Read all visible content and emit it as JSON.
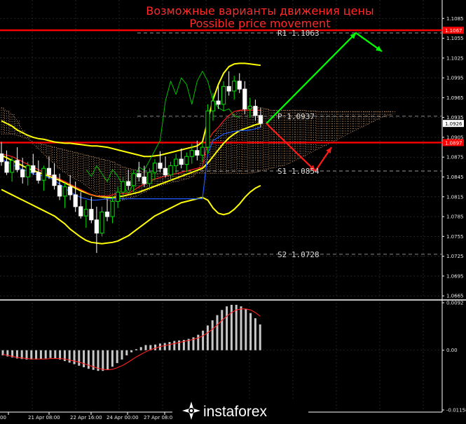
{
  "title_ru": "Возможные варианты движения цены",
  "title_en": "Possible price movement",
  "logo_text": "instaforex",
  "colors": {
    "background": "#000000",
    "title": "#ff2a2a",
    "bull_candle": "#00e000",
    "bear_candle": "#ffffff",
    "bollinger": "#ffff00",
    "kijun": "#ff2020",
    "tenkan": "#1e5aff",
    "chikou": "#00c000",
    "cloud": "#d2a070",
    "level_line": "#ff0000",
    "arrow_up": "#00ff00",
    "arrow_down": "#ff1a1a",
    "histogram": "#c8c8c8",
    "signal": "#ff2020"
  },
  "chart_data": [
    {
      "type": "candlestick",
      "price_axis_ticks": [
        "1.1085",
        "1.1055",
        "1.1025",
        "1.0995",
        "1.0965",
        "1.0935",
        "1.0905",
        "1.0875",
        "1.0845",
        "1.0815",
        "1.0785",
        "1.0755",
        "1.0725",
        "1.0695",
        "1.0665"
      ],
      "ylim": [
        1.0662,
        1.1098
      ],
      "time_axis_ticks": [
        "00",
        "21 Apr 08:00",
        "22 Apr 16:00",
        "24 Apr 00:00",
        "27 Apr 08:00",
        "28 Ap"
      ],
      "price_badges": [
        {
          "label": "1.1067",
          "value": 1.1067,
          "color": "#ff0000"
        },
        {
          "label": "1.0926",
          "value": 1.0926,
          "color": "#ffffff"
        },
        {
          "label": "1.0897",
          "value": 1.0897,
          "color": "#ff0000"
        }
      ],
      "levels": [
        {
          "label": "R1 1.1063",
          "value": 1.1063,
          "style": "dash"
        },
        {
          "label": "P 1.0937",
          "value": 1.0937,
          "style": "dash"
        },
        {
          "label": "S1 1.0854",
          "value": 1.0854,
          "style": "dash"
        },
        {
          "label": "S2 1.0728",
          "value": 1.0728,
          "style": "dash"
        }
      ],
      "red_lines": [
        1.1067,
        1.0897
      ],
      "candles": [
        [
          1.088,
          1.0898,
          1.0862,
          1.0868
        ],
        [
          1.0868,
          1.0885,
          1.0848,
          1.0852
        ],
        [
          1.0852,
          1.0875,
          1.0838,
          1.087
        ],
        [
          1.087,
          1.089,
          1.0852,
          1.0856
        ],
        [
          1.0856,
          1.0874,
          1.0835,
          1.0845
        ],
        [
          1.0845,
          1.0868,
          1.0832,
          1.0862
        ],
        [
          1.0862,
          1.088,
          1.0848,
          1.0852
        ],
        [
          1.0852,
          1.087,
          1.0835,
          1.084
        ],
        [
          1.084,
          1.0862,
          1.0824,
          1.0858
        ],
        [
          1.0858,
          1.0876,
          1.0842,
          1.0848
        ],
        [
          1.0848,
          1.0866,
          1.0826,
          1.0832
        ],
        [
          1.0832,
          1.085,
          1.081,
          1.0816
        ],
        [
          1.0816,
          1.0836,
          1.0798,
          1.083
        ],
        [
          1.083,
          1.0848,
          1.081,
          1.0818
        ],
        [
          1.0818,
          1.0838,
          1.0792,
          1.08
        ],
        [
          1.08,
          1.0822,
          1.0782,
          1.0786
        ],
        [
          1.0786,
          1.081,
          1.0768,
          1.0796
        ],
        [
          1.0796,
          1.0815,
          1.0775,
          1.078
        ],
        [
          1.078,
          1.08,
          1.073,
          1.076
        ],
        [
          1.076,
          1.08,
          1.0755,
          1.0792
        ],
        [
          1.0792,
          1.0812,
          1.0778,
          1.0785
        ],
        [
          1.0785,
          1.0815,
          1.0775,
          1.0808
        ],
        [
          1.0808,
          1.083,
          1.0798,
          1.0822
        ],
        [
          1.0822,
          1.0845,
          1.081,
          1.0838
        ],
        [
          1.0838,
          1.0856,
          1.0825,
          1.0832
        ],
        [
          1.0832,
          1.0855,
          1.0822,
          1.085
        ],
        [
          1.085,
          1.0868,
          1.0838,
          1.0845
        ],
        [
          1.0845,
          1.0862,
          1.083,
          1.0835
        ],
        [
          1.0835,
          1.0858,
          1.0825,
          1.0852
        ],
        [
          1.0852,
          1.0872,
          1.084,
          1.0866
        ],
        [
          1.0866,
          1.0884,
          1.0852,
          1.0858
        ],
        [
          1.0858,
          1.0876,
          1.0844,
          1.0848
        ],
        [
          1.0848,
          1.0868,
          1.0838,
          1.0862
        ],
        [
          1.0862,
          1.088,
          1.085,
          1.0872
        ],
        [
          1.0872,
          1.0888,
          1.0858,
          1.0864
        ],
        [
          1.0864,
          1.0882,
          1.0852,
          1.0876
        ],
        [
          1.0876,
          1.0895,
          1.0865,
          1.0885
        ],
        [
          1.0885,
          1.09,
          1.087,
          1.0878
        ],
        [
          1.0878,
          1.0898,
          1.0868,
          1.089
        ],
        [
          1.089,
          1.0955,
          1.088,
          1.0945
        ],
        [
          1.0945,
          1.0972,
          1.093,
          1.096
        ],
        [
          1.096,
          1.0985,
          1.0948,
          1.0955
        ],
        [
          1.0955,
          1.099,
          1.0945,
          1.0982
        ],
        [
          1.0982,
          1.1005,
          1.0968,
          1.0975
        ],
        [
          1.0975,
          1.0998,
          1.0962,
          1.099
        ],
        [
          1.099,
          1.1002,
          1.0972,
          1.0978
        ],
        [
          1.0978,
          1.099,
          1.094,
          1.0948
        ],
        [
          1.0948,
          1.0965,
          1.0935,
          1.0952
        ],
        [
          1.0952,
          1.0962,
          1.093,
          1.0938
        ],
        [
          1.0938,
          1.095,
          1.092,
          1.0926
        ]
      ],
      "bollinger_upper": [
        1.093,
        1.0926,
        1.0922,
        1.0916,
        1.0912,
        1.0908,
        1.0905,
        1.0903,
        1.0902,
        1.09,
        1.0898,
        1.0897,
        1.0896,
        1.0896,
        1.0895,
        1.0894,
        1.0893,
        1.0892,
        1.0892,
        1.0891,
        1.089,
        1.0888,
        1.0886,
        1.0884,
        1.0882,
        1.088,
        1.0878,
        1.0876,
        1.0876,
        1.0877,
        1.0878,
        1.088,
        1.0882,
        1.0884,
        1.0886,
        1.0888,
        1.089,
        1.0892,
        1.0898,
        1.093,
        1.0962,
        1.0985,
        1.1002,
        1.1012,
        1.1016,
        1.1017,
        1.1017,
        1.1016,
        1.1015,
        1.1014
      ],
      "bollinger_middle": [
        1.0878,
        1.0874,
        1.087,
        1.0866,
        1.0862,
        1.0858,
        1.0855,
        1.0852,
        1.0849,
        1.0846,
        1.0843,
        1.084,
        1.0836,
        1.0832,
        1.0828,
        1.0824,
        1.0821,
        1.0818,
        1.0816,
        1.0815,
        1.0814,
        1.0814,
        1.0815,
        1.0816,
        1.0818,
        1.082,
        1.0822,
        1.0825,
        1.0828,
        1.0831,
        1.0834,
        1.0837,
        1.084,
        1.0843,
        1.0846,
        1.0849,
        1.0852,
        1.0855,
        1.0858,
        1.0866,
        1.0876,
        1.0886,
        1.0896,
        1.0904,
        1.091,
        1.0915,
        1.0918,
        1.0921,
        1.0924,
        1.0926
      ],
      "bollinger_lower": [
        1.0826,
        1.0822,
        1.0818,
        1.0814,
        1.081,
        1.0806,
        1.0802,
        1.0798,
        1.0794,
        1.079,
        1.0786,
        1.078,
        1.0774,
        1.0766,
        1.076,
        1.0754,
        1.0749,
        1.0746,
        1.0745,
        1.0744,
        1.0745,
        1.0746,
        1.0748,
        1.0752,
        1.0756,
        1.0762,
        1.0768,
        1.0774,
        1.078,
        1.0786,
        1.079,
        1.0794,
        1.0798,
        1.0802,
        1.0806,
        1.0808,
        1.081,
        1.0812,
        1.0814,
        1.081,
        1.0798,
        1.079,
        1.0788,
        1.079,
        1.0796,
        1.0804,
        1.0814,
        1.0822,
        1.0828,
        1.0832
      ],
      "tenkan": [
        1.0872,
        1.0868,
        1.0864,
        1.086,
        1.0856,
        1.0853,
        1.085,
        1.0848,
        1.0846,
        1.0844,
        1.084,
        1.0834,
        1.0828,
        1.0822,
        1.0818,
        1.0814,
        1.0812,
        1.081,
        1.081,
        1.0811,
        1.0812,
        1.0812,
        1.0812,
        1.0812,
        1.0812,
        1.0812,
        1.0812,
        1.0812,
        1.0812,
        1.0812,
        1.0812,
        1.0812,
        1.0812,
        1.0812,
        1.0812,
        1.0812,
        1.0812,
        1.0812,
        1.0812,
        1.088,
        1.09,
        1.0905,
        1.091,
        1.0912,
        1.0914,
        1.0915,
        1.0915,
        1.0916,
        1.0918,
        1.092
      ],
      "kijun": [
        1.088,
        1.0878,
        1.0876,
        1.0872,
        1.0868,
        1.0864,
        1.086,
        1.0856,
        1.0852,
        1.0848,
        1.0846,
        1.0842,
        1.0838,
        1.0834,
        1.083,
        1.0826,
        1.0822,
        1.0818,
        1.0816,
        1.0816,
        1.0816,
        1.0818,
        1.082,
        1.082,
        1.082,
        1.0825,
        1.083,
        1.0834,
        1.0838,
        1.0842,
        1.0844,
        1.0846,
        1.0848,
        1.085,
        1.0852,
        1.0854,
        1.0856,
        1.0858,
        1.086,
        1.09,
        1.0912,
        1.092,
        1.093,
        1.0938,
        1.0944,
        1.0946,
        1.0946,
        1.0946,
        1.0946,
        1.0946
      ],
      "chikou": [
        1.0856,
        1.0846,
        1.0862,
        1.085,
        1.0838,
        1.0856,
        1.0846,
        1.0832,
        1.082,
        1.0836,
        1.086,
        1.0855,
        1.087,
        1.0885,
        1.09,
        1.096,
        1.099,
        1.097,
        1.0995,
        1.0985,
        1.0955,
        1.099,
        1.1005,
        1.099,
        1.096,
        1.095,
        1.0945,
        1.0948,
        1.0938,
        1.0935
      ],
      "cloud_a": [
        1.095,
        1.0945,
        1.094,
        1.093,
        1.0915,
        1.0905,
        1.0895,
        1.0888,
        1.088,
        1.0872,
        1.0865,
        1.0858,
        1.0852,
        1.0846,
        1.0842,
        1.0838,
        1.0832,
        1.0826,
        1.082,
        1.0814,
        1.081,
        1.0808,
        1.0808,
        1.081,
        1.0812,
        1.0814,
        1.0818,
        1.0822,
        1.0826,
        1.083,
        1.0832,
        1.0834,
        1.0836,
        1.0838,
        1.084,
        1.0842,
        1.0845,
        1.0852,
        1.087,
        1.089,
        1.0902,
        1.0915,
        1.0926,
        1.0935,
        1.094,
        1.0945,
        1.0948,
        1.095,
        1.095,
        1.095,
        1.0948,
        1.0946,
        1.0946,
        1.0946,
        1.0946,
        1.0946,
        1.0946,
        1.0946,
        1.0945,
        1.0945,
        1.0944,
        1.0944,
        1.0944,
        1.0944,
        1.0944,
        1.0944,
        1.0944,
        1.0944,
        1.0944,
        1.0944,
        1.0944,
        1.0944,
        1.0944,
        1.0944,
        1.0944
      ],
      "cloud_b": [
        1.091,
        1.091,
        1.091,
        1.0908,
        1.0905,
        1.0902,
        1.0898,
        1.0896,
        1.0894,
        1.0892,
        1.089,
        1.0888,
        1.0886,
        1.0884,
        1.0882,
        1.088,
        1.0878,
        1.0876,
        1.0874,
        1.0872,
        1.087,
        1.0868,
        1.0864,
        1.086,
        1.0858,
        1.0856,
        1.0854,
        1.0852,
        1.085,
        1.085,
        1.085,
        1.085,
        1.085,
        1.085,
        1.085,
        1.085,
        1.085,
        1.085,
        1.085,
        1.085,
        1.085,
        1.085,
        1.085,
        1.085,
        1.085,
        1.085,
        1.085,
        1.085,
        1.0852,
        1.0854,
        1.0856,
        1.0858,
        1.086,
        1.0862,
        1.0864,
        1.0868,
        1.0872,
        1.0876,
        1.088,
        1.0884,
        1.0888,
        1.0892,
        1.0896,
        1.09,
        1.0904,
        1.0908,
        1.0912,
        1.0916,
        1.092,
        1.0924,
        1.0928,
        1.0932,
        1.0936,
        1.0938,
        1.094
      ],
      "scenario_up": [
        [
          1.0926,
          1.0926
        ],
        [
          1.1063,
          1.1063
        ],
        [
          1.1035,
          1.1035
        ]
      ],
      "scenario_down": [
        [
          1.0926,
          1.0926
        ],
        [
          1.0854,
          1.0854
        ],
        [
          1.089,
          1.089
        ]
      ]
    },
    {
      "type": "histogram",
      "axis_ticks": [
        "0.0092",
        "0.00",
        "-0.01158"
      ],
      "ylim": [
        -0.01158,
        0.0092
      ],
      "values": [
        -0.001,
        -0.0012,
        -0.0014,
        -0.0016,
        -0.0017,
        -0.0018,
        -0.0018,
        -0.0018,
        -0.0017,
        -0.0016,
        -0.0015,
        -0.0016,
        -0.0018,
        -0.0021,
        -0.0024,
        -0.0027,
        -0.003,
        -0.0033,
        -0.0036,
        -0.0038,
        -0.004,
        -0.004,
        -0.0038,
        -0.0032,
        -0.0025,
        -0.0018,
        -0.001,
        -0.0004,
        0.0002,
        0.0006,
        0.001,
        0.001,
        0.0011,
        0.0013,
        0.0014,
        0.0016,
        0.0018,
        0.0019,
        0.002,
        0.0022,
        0.0025,
        0.003,
        0.0038,
        0.0048,
        0.0058,
        0.0068,
        0.0078,
        0.0085,
        0.0088,
        0.0088,
        0.0085,
        0.008,
        0.0072,
        0.0062,
        0.005
      ],
      "signal": [
        -0.0008,
        -0.001,
        -0.0012,
        -0.0014,
        -0.0015,
        -0.0016,
        -0.0017,
        -0.0017,
        -0.0017,
        -0.0017,
        -0.0016,
        -0.0016,
        -0.0016,
        -0.0017,
        -0.0019,
        -0.0021,
        -0.0023,
        -0.0026,
        -0.0029,
        -0.0032,
        -0.0035,
        -0.0037,
        -0.0038,
        -0.0037,
        -0.0034,
        -0.003,
        -0.0025,
        -0.0019,
        -0.0013,
        -0.0008,
        -0.0003,
        0.0001,
        0.0004,
        0.0007,
        0.0009,
        0.0011,
        0.0013,
        0.0015,
        0.0017,
        0.0019,
        0.0021,
        0.0024,
        0.0028,
        0.0034,
        0.0041,
        0.0049,
        0.0058,
        0.0066,
        0.0073,
        0.0078,
        0.008,
        0.008,
        0.0078,
        0.0073,
        0.0066
      ]
    }
  ]
}
